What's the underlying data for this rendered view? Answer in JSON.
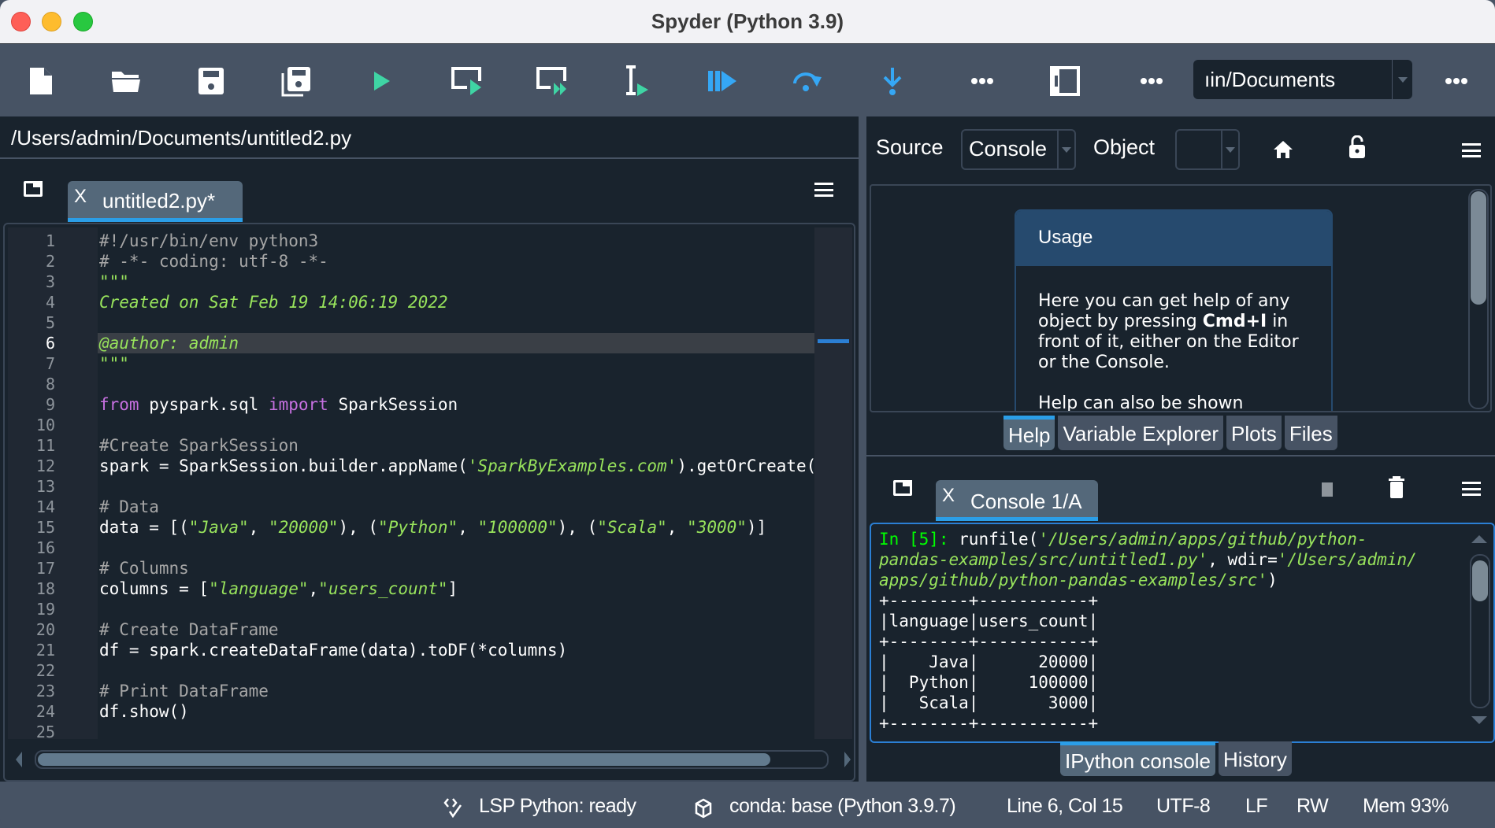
{
  "window": {
    "title": "Spyder (Python 3.9)"
  },
  "toolbar": {
    "buttons": [
      {
        "name": "new-file",
        "icon": "new-file-icon"
      },
      {
        "name": "open-file",
        "icon": "open-folder-icon"
      },
      {
        "name": "save-file",
        "icon": "save-icon"
      },
      {
        "name": "save-all",
        "icon": "save-all-icon"
      },
      {
        "name": "run-file",
        "icon": "run-icon"
      },
      {
        "name": "run-cell",
        "icon": "run-cell-icon"
      },
      {
        "name": "run-cell-advance",
        "icon": "run-cell-advance-icon"
      },
      {
        "name": "run-selection",
        "icon": "run-selection-icon"
      },
      {
        "name": "debug-file",
        "icon": "debug-continue-icon"
      },
      {
        "name": "debug-step",
        "icon": "step-over-icon"
      },
      {
        "name": "debug-step-into",
        "icon": "step-into-icon"
      },
      {
        "name": "more-debug",
        "icon": "more-icon"
      },
      {
        "name": "maximize-pane",
        "icon": "maximize-pane-icon"
      },
      {
        "name": "more-layout",
        "icon": "more-icon"
      }
    ],
    "working_directory": "ıin/Documents",
    "more_label": "•••"
  },
  "editor": {
    "file_path": "/Users/admin/Documents/untitled2.py",
    "tab_label": "untitled2.py*",
    "tab_close": "X",
    "current_line": 6,
    "horizontal_scroll_fraction": 0.93,
    "lines": [
      {
        "n": "1",
        "tokens": [
          {
            "t": "comment",
            "v": "#!/usr/bin/env python3"
          }
        ]
      },
      {
        "n": "2",
        "tokens": [
          {
            "t": "comment",
            "v": "# -*- coding: utf-8 -*-"
          }
        ]
      },
      {
        "n": "3",
        "tokens": [
          {
            "t": "string",
            "v": "\"\"\""
          }
        ]
      },
      {
        "n": "4",
        "tokens": [
          {
            "t": "string",
            "v": "Created on Sat Feb 19 14:06:19 2022"
          }
        ]
      },
      {
        "n": "5",
        "tokens": []
      },
      {
        "n": "6",
        "tokens": [
          {
            "t": "string",
            "v": "@author: admin"
          }
        ]
      },
      {
        "n": "7",
        "tokens": [
          {
            "t": "string",
            "v": "\"\"\""
          }
        ]
      },
      {
        "n": "8",
        "tokens": []
      },
      {
        "n": "9",
        "tokens": [
          {
            "t": "kw",
            "v": "from"
          },
          {
            "t": "plain",
            "v": " pyspark.sql "
          },
          {
            "t": "kw",
            "v": "import"
          },
          {
            "t": "plain",
            "v": " SparkSession"
          }
        ]
      },
      {
        "n": "10",
        "tokens": []
      },
      {
        "n": "11",
        "tokens": [
          {
            "t": "comment",
            "v": "#Create SparkSession"
          }
        ]
      },
      {
        "n": "12",
        "tokens": [
          {
            "t": "plain",
            "v": "spark = SparkSession.builder.appName("
          },
          {
            "t": "string",
            "v": "'SparkByExamples.com'"
          },
          {
            "t": "plain",
            "v": ").getOrCreate()"
          }
        ]
      },
      {
        "n": "13",
        "tokens": []
      },
      {
        "n": "14",
        "tokens": [
          {
            "t": "comment",
            "v": "# Data"
          }
        ]
      },
      {
        "n": "15",
        "tokens": [
          {
            "t": "plain",
            "v": "data = [("
          },
          {
            "t": "string",
            "v": "\"Java\""
          },
          {
            "t": "plain",
            "v": ", "
          },
          {
            "t": "string",
            "v": "\"20000\""
          },
          {
            "t": "plain",
            "v": "), ("
          },
          {
            "t": "string",
            "v": "\"Python\""
          },
          {
            "t": "plain",
            "v": ", "
          },
          {
            "t": "string",
            "v": "\"100000\""
          },
          {
            "t": "plain",
            "v": "), ("
          },
          {
            "t": "string",
            "v": "\"Scala\""
          },
          {
            "t": "plain",
            "v": ", "
          },
          {
            "t": "string",
            "v": "\"3000\""
          },
          {
            "t": "plain",
            "v": ")]"
          }
        ]
      },
      {
        "n": "16",
        "tokens": []
      },
      {
        "n": "17",
        "tokens": [
          {
            "t": "comment",
            "v": "# Columns"
          }
        ]
      },
      {
        "n": "18",
        "tokens": [
          {
            "t": "plain",
            "v": "columns = ["
          },
          {
            "t": "string",
            "v": "\"language\""
          },
          {
            "t": "plain",
            "v": ","
          },
          {
            "t": "string",
            "v": "\"users_count\""
          },
          {
            "t": "plain",
            "v": "]"
          }
        ]
      },
      {
        "n": "19",
        "tokens": []
      },
      {
        "n": "20",
        "tokens": [
          {
            "t": "comment",
            "v": "# Create DataFrame"
          }
        ]
      },
      {
        "n": "21",
        "tokens": [
          {
            "t": "plain",
            "v": "df = spark.createDataFrame(data).toDF(*columns)"
          }
        ]
      },
      {
        "n": "22",
        "tokens": []
      },
      {
        "n": "23",
        "tokens": [
          {
            "t": "comment",
            "v": "# Print DataFrame"
          }
        ]
      },
      {
        "n": "24",
        "tokens": [
          {
            "t": "plain",
            "v": "df.show()"
          }
        ]
      },
      {
        "n": "25",
        "tokens": []
      }
    ]
  },
  "help": {
    "source_label": "Source",
    "source_value": "Console",
    "object_label": "Object",
    "object_value": "",
    "card_title": "Usage",
    "card_body_1a": "Here you can get help of any object by pressing ",
    "card_body_1b": "Cmd+I",
    "card_body_1c": " in front of it, either on the Editor or the Console.",
    "card_body_2": "Help can also be shown",
    "scroll_fraction": 0.0,
    "tabs": [
      {
        "label": "Help",
        "active": true
      },
      {
        "label": "Variable Explorer",
        "active": false
      },
      {
        "label": "Plots",
        "active": false
      },
      {
        "label": "Files",
        "active": false
      }
    ]
  },
  "console": {
    "tab_label": "Console 1/A",
    "tab_close": "X",
    "prompt": "In [5]: ",
    "command_parts": [
      {
        "t": "plain",
        "v": "runfile("
      },
      {
        "t": "string",
        "v": "'/Users/admin/apps/github/python-\npandas-examples/src/untitled1.py'"
      },
      {
        "t": "plain",
        "v": ", wdir="
      },
      {
        "t": "string",
        "v": "'/Users/admin/\napps/github/python-pandas-examples/src'"
      },
      {
        "t": "plain",
        "v": ")"
      }
    ],
    "output": "+--------+-----------+\n|language|users_count|\n+--------+-----------+\n|    Java|      20000|\n|  Python|     100000|\n|   Scala|       3000|\n+--------+-----------+",
    "table": {
      "columns": [
        "language",
        "users_count"
      ],
      "rows": [
        [
          "Java",
          "20000"
        ],
        [
          "Python",
          "100000"
        ],
        [
          "Scala",
          "3000"
        ]
      ]
    },
    "tabs": [
      {
        "label": "IPython console",
        "active": true
      },
      {
        "label": "History",
        "active": false
      }
    ]
  },
  "statusbar": {
    "lsp": "LSP Python: ready",
    "conda": "conda: base (Python 3.9.7)",
    "cursor": "Line 6, Col 15",
    "encoding": "UTF-8",
    "eol": "LF",
    "permissions": "RW",
    "memory": "Mem 93%"
  },
  "colors": {
    "accent": "#2b9ee7",
    "run_green": "#3fd4a4",
    "debug_blue": "#35a7f5",
    "background": "#19232d",
    "chrome": "#475364"
  }
}
